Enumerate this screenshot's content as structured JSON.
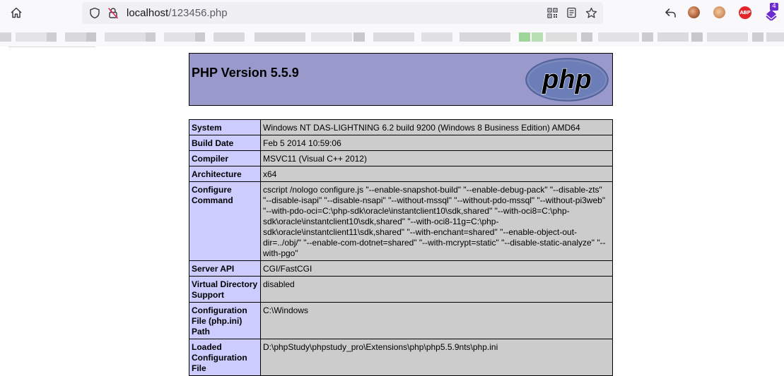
{
  "browser": {
    "url_host": "localhost",
    "url_path": "/123456.php",
    "badge_count": "4",
    "abp_label": "ABP",
    "icons": [
      "home-icon",
      "shield-icon",
      "insecure-lock-icon",
      "qr-code-icon",
      "reader-view-icon",
      "bookmark-star-icon",
      "back-arrow-icon",
      "extension-avatar-icon",
      "abp-icon",
      "extension-puzzle-icon"
    ],
    "accent": "#6b2bd1"
  },
  "phpinfo": {
    "title": "PHP Version 5.5.9",
    "logo_text": "php",
    "header_color": "#9999cc",
    "key_color": "#ccccff",
    "value_color": "#cccccc",
    "rows": [
      {
        "key": "System",
        "value": "Windows NT DAS-LIGHTNING 6.2 build 9200 (Windows 8 Business Edition) AMD64"
      },
      {
        "key": "Build Date",
        "value": "Feb 5 2014 10:59:06"
      },
      {
        "key": "Compiler",
        "value": "MSVC11 (Visual C++ 2012)"
      },
      {
        "key": "Architecture",
        "value": "x64"
      },
      {
        "key": "Configure Command",
        "value": "cscript /nologo configure.js \"--enable-snapshot-build\" \"--enable-debug-pack\" \"--disable-zts\" \"--disable-isapi\" \"--disable-nsapi\" \"--without-mssql\" \"--without-pdo-mssql\" \"--without-pi3web\" \"--with-pdo-oci=C:\\php-sdk\\oracle\\instantclient10\\sdk,shared\" \"--with-oci8=C:\\php-sdk\\oracle\\instantclient10\\sdk,shared\" \"--with-oci8-11g=C:\\php-sdk\\oracle\\instantclient11\\sdk,shared\" \"--with-enchant=shared\" \"--enable-object-out-dir=../obj/\" \"--enable-com-dotnet=shared\" \"--with-mcrypt=static\" \"--disable-static-analyze\" \"--with-pgo\""
      },
      {
        "key": "Server API",
        "value": "CGI/FastCGI"
      },
      {
        "key": "Virtual Directory Support",
        "value": "disabled"
      },
      {
        "key": "Configuration File (php.ini) Path",
        "value": "C:\\Windows"
      },
      {
        "key": "Loaded Configuration File",
        "value": "D:\\phpStudy\\phpstudy_pro\\Extensions\\php\\php5.5.9nts\\php.ini"
      }
    ]
  }
}
